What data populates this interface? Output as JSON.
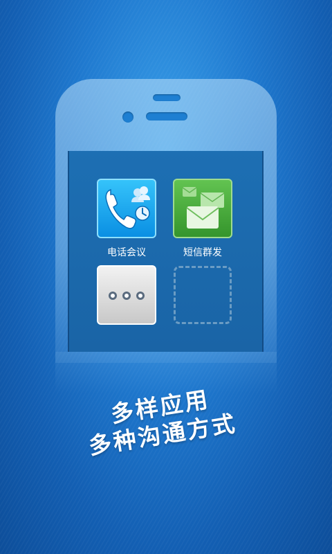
{
  "apps": [
    {
      "label": "电话会议",
      "icon": "phone-conference-icon"
    },
    {
      "label": "短信群发",
      "icon": "group-sms-icon"
    },
    {
      "label": "",
      "icon": "more-dots-icon"
    },
    {
      "label": "",
      "icon": "empty-slot-placeholder"
    }
  ],
  "headline": {
    "line1": "多样应用",
    "line2": "多种沟通方式"
  },
  "colors": {
    "background": "#1f79cf",
    "phone_app": "#1aa6f0",
    "sms_app": "#4aad3c",
    "more_app": "#dcdcdc"
  }
}
